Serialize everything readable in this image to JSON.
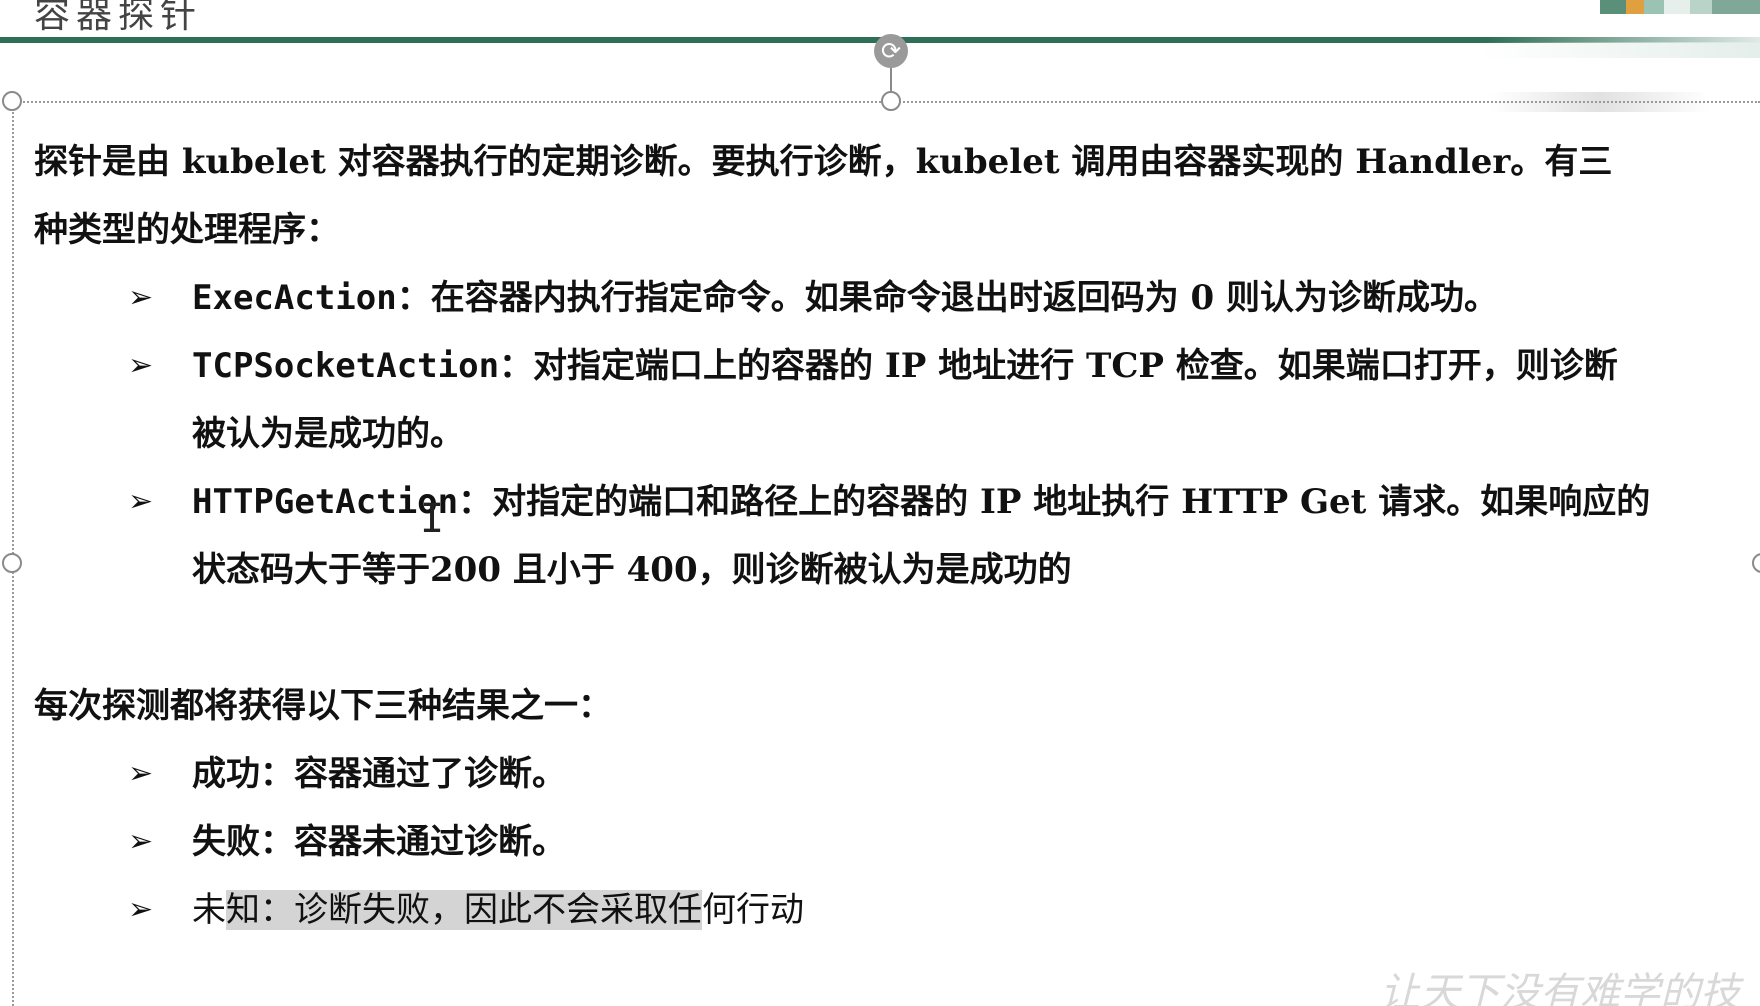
{
  "slide": {
    "title": "容器探针"
  },
  "intro": {
    "lines": [
      "探针是由 kubelet 对容器执行的定期诊断。要执行诊断，kubelet 调用由容器实现的 Handler。有三",
      "种类型的处理程序："
    ]
  },
  "handlers": [
    {
      "name": "ExecAction",
      "lines": [
        "：在容器内执行指定命令。如果命令退出时返回码为 0 则认为诊断成功。"
      ]
    },
    {
      "name": "TCPSocketAction",
      "lines": [
        "：对指定端口上的容器的 IP 地址进行 TCP 检查。如果端口打开，则诊断",
        "被认为是成功的。"
      ]
    },
    {
      "name": "HTTPGetAction",
      "lines": [
        "：对指定的端口和路径上的容器的 IP 地址执行 HTTP Get 请求。如果响应的",
        "状态码大于等于200 且小于 400，则诊断被认为是成功的"
      ]
    }
  ],
  "results": {
    "heading": "每次探测都将获得以下三种结果之一：",
    "items": [
      "成功：容器通过了诊断。",
      "失败：容器未通过诊断。"
    ],
    "last_item": {
      "head": "未",
      "highlighted": "知：诊断失败，因此不会采取任",
      "tail": "何行动"
    }
  },
  "bullet_glyph": "➢",
  "rotate_glyph": "⟳",
  "watermark": "让天下没有难学的技",
  "colors": {
    "title_rule": "#2f6f57",
    "selection_highlight": "#d4d4d4"
  }
}
